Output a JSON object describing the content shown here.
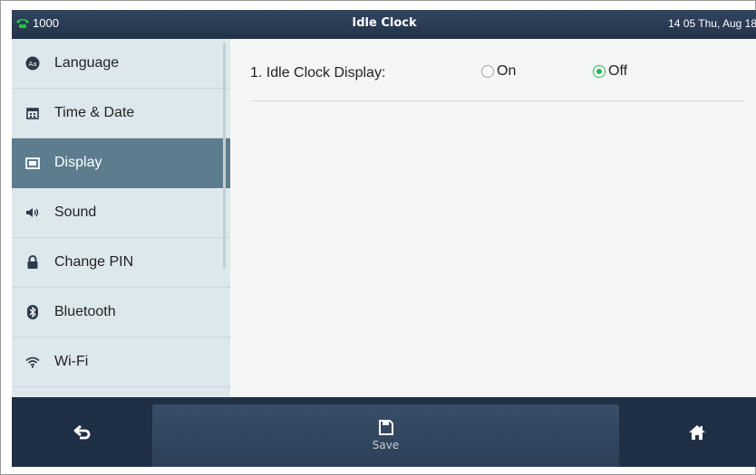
{
  "status_bar": {
    "account": "1000",
    "title": "Idle Clock",
    "datetime": "14 05 Thu, Aug 18"
  },
  "sidebar": {
    "items": [
      {
        "label": "Language",
        "icon": "language-icon",
        "active": false
      },
      {
        "label": "Time & Date",
        "icon": "calendar-icon",
        "active": false
      },
      {
        "label": "Display",
        "icon": "display-icon",
        "active": true
      },
      {
        "label": "Sound",
        "icon": "speaker-icon",
        "active": false
      },
      {
        "label": "Change PIN",
        "icon": "lock-icon",
        "active": false
      },
      {
        "label": "Bluetooth",
        "icon": "bluetooth-icon",
        "active": false
      },
      {
        "label": "Wi-Fi",
        "icon": "wifi-icon",
        "active": false
      }
    ]
  },
  "content": {
    "setting": {
      "label": "1. Idle Clock Display:",
      "options": [
        "On",
        "Off"
      ],
      "selected": "Off"
    }
  },
  "softkeys": {
    "back_icon": "back-arrow-icon",
    "save_label": "Save",
    "save_icon": "save-icon",
    "home_icon": "home-icon"
  },
  "colors": {
    "accent_green": "#2db256",
    "active_item": "#5d7d8f",
    "sidebar_bg": "#dde8ed",
    "bar_bg": "#1f2f45"
  }
}
